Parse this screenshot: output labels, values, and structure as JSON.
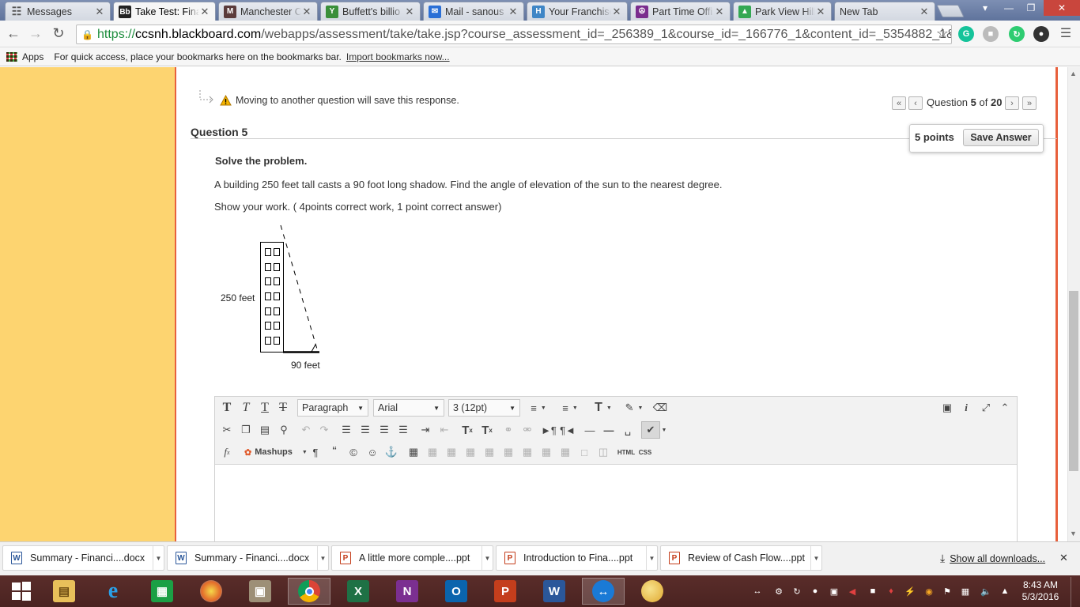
{
  "browser": {
    "tabs": [
      {
        "label": "Messages",
        "favicon": "Messages",
        "color": "#7a7a7a"
      },
      {
        "label": "Take Test: Fina",
        "favicon": "Bb",
        "color": "#222222"
      },
      {
        "label": "Manchester C",
        "favicon": "M",
        "color": "#5b3b3b"
      },
      {
        "label": "Buffett's billio",
        "favicon": "Y",
        "color": "#3a8f3a"
      },
      {
        "label": "Mail - sanous",
        "favicon": "mail-icon",
        "color": "#2a6fd6"
      },
      {
        "label": "Your Franchise",
        "favicon": "H",
        "color": "#3f86c6"
      },
      {
        "label": "Part Time Offi",
        "favicon": "peace-icon",
        "color": "#7b2d8e"
      },
      {
        "label": "Park View Hill",
        "favicon": "map-icon",
        "color": "#34a853"
      },
      {
        "label": "New Tab",
        "favicon": "",
        "color": "#ffffff"
      }
    ],
    "url_scheme": "https://",
    "url_host": "ccsnh.blackboard.com",
    "url_path": "/webapps/assessment/take/take.jsp?course_assessment_id=_256389_1&course_id=_166776_1&content_id=_5354882_1&",
    "apps_label": "Apps",
    "bookmarks_hint": "For quick access, place your bookmarks here on the bookmarks bar.",
    "import_link": "Import bookmarks now..."
  },
  "assessment": {
    "warning": "Moving to another question will save this response.",
    "question_nav_prefix": "Question",
    "question_current": "5",
    "question_of": "of",
    "question_total": "20",
    "question_title": "Question 5",
    "points": "5 points",
    "save_label": "Save Answer",
    "instruction": "Solve the problem.",
    "problem": "A building 250 feet tall casts a 90 foot long shadow. Find the angle of elevation of the sun to the nearest degree.",
    "show_work": "Show your work. ( 4points correct work, 1 point correct answer)",
    "figure": {
      "height_label": "250 feet",
      "shadow_label": "90 feet"
    }
  },
  "editor": {
    "format": "Paragraph",
    "font": "Arial",
    "size": "3 (12pt)",
    "mashups": "Mashups",
    "html_label": "HTML",
    "css_label": "CSS"
  },
  "downloads": {
    "items": [
      {
        "name": "Summary - Financi....docx",
        "type": "W",
        "color": "#2b579a"
      },
      {
        "name": "Summary - Financi....docx",
        "type": "W",
        "color": "#2b579a"
      },
      {
        "name": "A little more comple....ppt",
        "type": "P",
        "color": "#c43e1c"
      },
      {
        "name": "Introduction to Fina....ppt",
        "type": "P",
        "color": "#c43e1c"
      },
      {
        "name": "Review of Cash Flow....ppt",
        "type": "P",
        "color": "#c43e1c"
      }
    ],
    "show_all": "Show all downloads..."
  },
  "taskbar": {
    "time": "8:43 AM",
    "date": "5/3/2016"
  }
}
